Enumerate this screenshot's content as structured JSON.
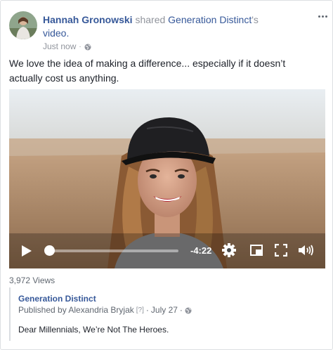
{
  "post": {
    "author": "Hannah Gronowski",
    "verb": "shared",
    "page": "Generation Distinct",
    "possessive": "'s",
    "object": "video.",
    "timestamp": "Just now",
    "separator": "·",
    "privacy_icon": "globe-icon",
    "text": "We love the idea of making a difference... especially if it doesn’t actually cost us anything."
  },
  "video": {
    "time_remaining": "-4:22",
    "progress": 0.0,
    "controls": [
      "play-icon",
      "gear-icon",
      "picture-in-picture-icon",
      "fullscreen-icon",
      "volume-icon"
    ]
  },
  "stats": {
    "views": "3,972 Views"
  },
  "original": {
    "page": "Generation Distinct",
    "published_by": "Published by Alexandria Bryjak",
    "help": "[?]",
    "separator": "·",
    "date": "July 27",
    "separator2": "·",
    "title": "Dear Millennials, We’re Not The Heroes."
  },
  "colors": {
    "link": "#365899",
    "meta": "#90949c",
    "text": "#1d2129"
  }
}
